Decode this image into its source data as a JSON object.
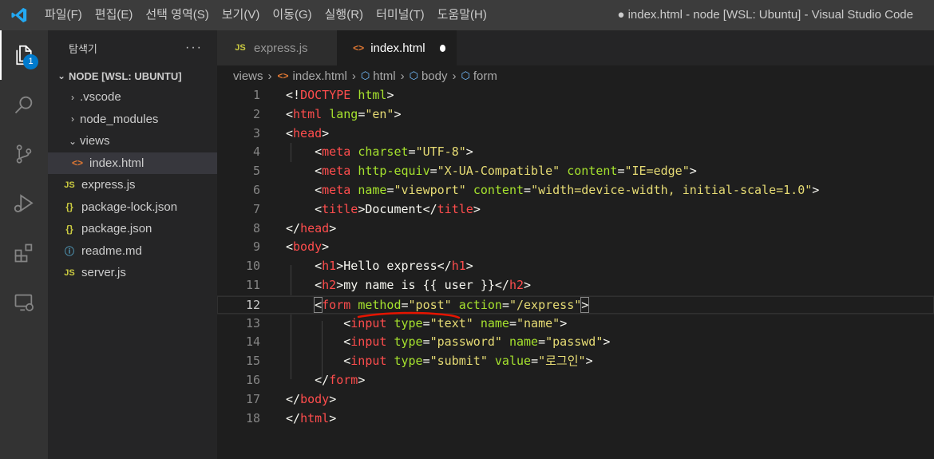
{
  "titlebar": {
    "menu": [
      "파일(F)",
      "편집(E)",
      "선택 영역(S)",
      "보기(V)",
      "이동(G)",
      "실행(R)",
      "터미널(T)",
      "도움말(H)"
    ],
    "window_title": "● index.html - node [WSL: Ubuntu] - Visual Studio Code"
  },
  "activitybar": {
    "items": [
      "explorer-icon",
      "search-icon",
      "source-control-icon",
      "run-debug-icon",
      "extensions-icon",
      "remote-explorer-icon"
    ],
    "explorer_badge": "1"
  },
  "sidebar": {
    "title": "탐색기",
    "more": "···",
    "section": "NODE [WSL: UBUNTU]",
    "items": [
      {
        "label": ".vscode",
        "kind": "folder"
      },
      {
        "label": "node_modules",
        "kind": "folder"
      },
      {
        "label": "views",
        "kind": "folder-open"
      },
      {
        "label": "index.html",
        "kind": "html"
      },
      {
        "label": "express.js",
        "kind": "js"
      },
      {
        "label": "package-lock.json",
        "kind": "json"
      },
      {
        "label": "package.json",
        "kind": "json"
      },
      {
        "label": "readme.md",
        "kind": "info"
      },
      {
        "label": "server.js",
        "kind": "js"
      }
    ]
  },
  "tabs": [
    {
      "label": "express.js",
      "icon": "JS",
      "active": false
    },
    {
      "label": "index.html",
      "icon": "<>",
      "active": true,
      "dirty": true
    }
  ],
  "breadcrumb": [
    "views",
    "index.html",
    "html",
    "body",
    "form"
  ],
  "editor": {
    "current_line": 12,
    "line_numbers": [
      "1",
      "2",
      "3",
      "4",
      "5",
      "6",
      "7",
      "8",
      "9",
      "10",
      "11",
      "12",
      "13",
      "14",
      "15",
      "16",
      "17",
      "18"
    ]
  },
  "colors": {
    "accent": "#007acc",
    "tag": "#ff4d4d",
    "attribute": "#a6e22e",
    "string": "#e6db74",
    "annotation": "#e51400"
  }
}
